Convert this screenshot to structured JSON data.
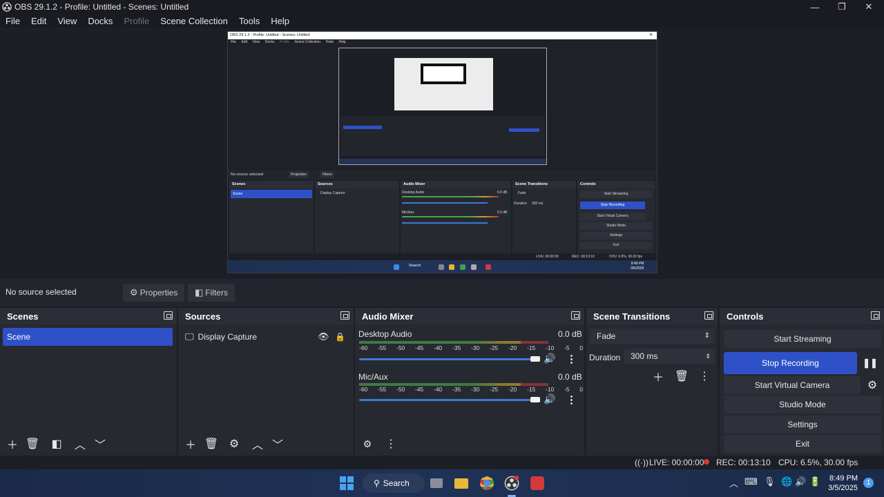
{
  "window": {
    "title": "OBS 29.1.2 - Profile: Untitled - Scenes: Untitled",
    "controls": {
      "minimize": "—",
      "maximize": "❐",
      "close": "✕"
    }
  },
  "menu": [
    "File",
    "Edit",
    "View",
    "Docks",
    "Profile",
    "Scene Collection",
    "Tools",
    "Help"
  ],
  "preview_nested": {
    "title": "OBS 29.1.2 - Profile: Untitled - Scenes: Untitled",
    "menu": [
      "File",
      "Edit",
      "View",
      "Docks",
      "Profile",
      "Scene Collection",
      "Tools",
      "Help"
    ],
    "no_source": "No source selected",
    "properties": "Properties",
    "filters": "Filters",
    "docks": [
      "Scenes",
      "Sources",
      "Audio Mixer",
      "Scene Transitions",
      "Controls"
    ],
    "scene": "Scene",
    "source": "Display Capture",
    "desktop_audio": "Desktop Audio",
    "mic_aux": "Mic/Aux",
    "db": "0.0 dB",
    "fade": "Fade",
    "duration_label": "Duration",
    "duration": "300 ms",
    "controls": [
      "Start Streaming",
      "Stop Recording",
      "Start Virtual Camera",
      "Studio Mode",
      "Settings",
      "Exit"
    ],
    "live": "LIVE: 00:00:00",
    "rec": "REC: 00:13:10",
    "cpu": "CPU: 6.5%, 30.00 fps",
    "search": "Search",
    "time": "8:49 PM",
    "date": "3/5/2025"
  },
  "source_bar": {
    "status": "No source selected",
    "properties": "Properties",
    "filters": "Filters"
  },
  "scenes": {
    "title": "Scenes",
    "items": [
      "Scene"
    ]
  },
  "sources": {
    "title": "Sources",
    "items": [
      "Display Capture"
    ]
  },
  "audio_mixer": {
    "title": "Audio Mixer",
    "channels": [
      {
        "name": "Desktop Audio",
        "db": "0.0 dB"
      },
      {
        "name": "Mic/Aux",
        "db": "0.0 dB"
      }
    ],
    "ticks": [
      "-60",
      "-55",
      "-50",
      "-45",
      "-40",
      "-35",
      "-30",
      "-25",
      "-20",
      "-15",
      "-10",
      "-5",
      "0"
    ]
  },
  "transitions": {
    "title": "Scene Transitions",
    "transition": "Fade",
    "duration_label": "Duration",
    "duration": "300 ms"
  },
  "controls": {
    "title": "Controls",
    "start_streaming": "Start Streaming",
    "stop_recording": "Stop Recording",
    "start_virtual_camera": "Start Virtual Camera",
    "studio_mode": "Studio Mode",
    "settings": "Settings",
    "exit": "Exit"
  },
  "status": {
    "live": "LIVE: 00:00:00",
    "rec": "REC: 00:13:10",
    "cpu": "CPU: 6.5%, 30.00 fps"
  },
  "taskbar": {
    "search": "Search",
    "time": "8:49 PM",
    "date": "3/5/2025",
    "notification_count": "1"
  },
  "colors": {
    "accent": "#2f51c8",
    "rec_dot": "#d33a3a",
    "panel": "#272931",
    "background": "#1d1f26"
  }
}
